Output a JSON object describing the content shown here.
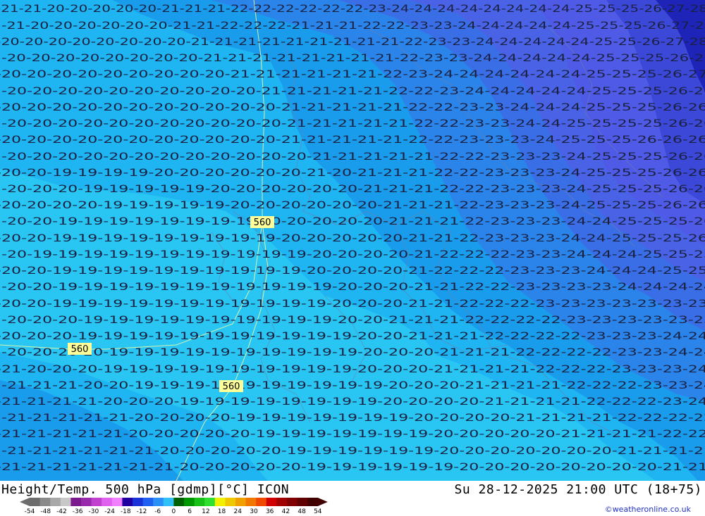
{
  "map": {
    "title": "Height/Temp. 500 hPa [gdmp][°C] ICON",
    "valid_time": "Su 28-12-2025 21:00 UTC (18+75)",
    "credit": "©weatheronline.co.uk",
    "colors": {
      "temp_minus19": "#29c6f4",
      "temp_minus20": "#1fb4f2",
      "temp_minus21": "#1a9cec",
      "temp_minus22": "#2b84ea",
      "temp_minus23": "#3a6ee6",
      "temp_minus24": "#4a63e6",
      "temp_minus25": "#4f5ae6",
      "temp_minus26": "#3c48d8",
      "temp_minus28": "#1e24b8",
      "height_contour": "#ffff99",
      "label_text": "#1a2140"
    },
    "height_labels": [
      "560",
      "560",
      "560"
    ],
    "iso_rows": [
      "21-21-20-20-20-20-20-21-21-21-22-22-22-22-22-22-23-24-24-24-24-24-24-24-24-25-25-25-26-27-28",
      "21-20-20-20-20-20-20-21-21-22-22-22-21-21-21-22-22-23-23-24-24-24-24-24-25-25-25-26-27-27",
      "20-20-20-20-20-20-20-20-21-21-21-21-21-21-21-21-21-22-23-23-24-24-24-24-24-25-25-26-27-28",
      "20-20-20-20-20-20-20-20-21-21-21-21-21-21-21-21-22-23-23-24-24-24-24-24-25-25-25-26-27",
      "20-20-20-20-20-20-20-20-20-21-21-21-21-21-21-22-23-24-24-24-24-24-24-25-25-25-26-27",
      "20-20-20-20-20-20-20-20-20-20-21-21-21-21-21-22-22-23-24-24-24-24-24-25-25-25-26-26",
      "20-20-20-20-20-20-20-20-20-20-20-21-21-21-21-21-22-22-23-23-24-24-24-25-25-25-26-26",
      "20-20-20-20-20-20-20-20-20-20-20-21-21-21-21-21-22-22-23-23-24-24-25-25-25-25-26-26",
      "20-20-20-20-20-20-20-20-20-20-20-21-21-21-21-21-22-22-23-23-23-24-25-25-25-26-26-26",
      "20-20-20-20-20-20-20-20-20-20-20-20-21-21-21-21-21-22-22-23-23-23-24-25-25-25-26-26",
      "20-20-19-19-19-19-20-20-20-20-20-20-21-20-21-21-21-22-22-23-23-23-24-25-25-25-26-26",
      "20-20-20-19-19-19-19-19-20-20-20-20-20-20-21-21-21-22-22-23-23-23-24-25-25-25-26-26",
      "20-20-20-20-19-19-19-19-19-20-20-20-20-20-20-21-21-21-22-23-23-23-24-25-25-25-26-26",
      "20-20-19-19-19-19-19-19-19-19-20-20-20-20-20-21-21-21-22-23-23-23-24-24-25-25-25-26",
      "20-20-19-19-19-19-19-19-19-19-19-20-20-20-20-20-21-21-22-23-23-23-24-24-25-25-25-26",
      "20-19-19-19-19-19-19-19-19-19-19-19-20-20-20-20-21-22-22-22-23-23-24-24-24-25-25-25",
      "20-20-19-19-19-19-19-19-19-19-19-19-20-20-20-20-21-22-22-22-23-23-23-24-24-24-25-25",
      "20-20-19-19-19-19-19-19-19-19-19-19-19-20-20-20-21-21-22-22-23-23-23-23-24-24-24-24",
      "20-20-19-19-19-19-19-19-19-19-19-19-19-20-20-20-21-21-22-22-22-23-23-23-23-23-23-23",
      "20-20-20-19-19-19-19-19-19-19-19-19-19-20-20-21-21-21-22-22-22-22-23-23-23-23-23-23",
      "20-20-20-19-19-19-19-19-19-19-19-19-19-19-20-20-21-21-21-22-22-22-22-23-23-23-24-24",
      "20-20-20-20-19-19-19-19-19-19-19-19-19-19-20-20-20-21-21-21-22-22-22-22-23-23-24-24",
      "21-20-20-20-19-19-19-19-19-19-19-19-19-19-20-20-20-21-21-21-21-22-22-22-23-23-23-24",
      "21-21-21-20-20-19-19-19-19-19-19-19-19-19-19-20-20-20-21-21-21-21-22-22-22-23-23-24",
      "21-21-21-21-20-20-20-19-19-19-19-19-19-19-19-20-20-20-20-21-21-21-21-22-22-22-23-24",
      "21-21-21-21-21-20-20-20-20-19-19-19-19-19-19-19-20-20-20-20-21-21-21-21-22-22-22-22",
      "21-21-21-21-21-20-20-20-20-20-19-19-19-19-19-19-19-20-20-20-20-20-21-21-21-21-22-22",
      "21-21-21-21-21-21-20-20-20-20-20-19-19-19-19-19-19-20-20-20-20-20-20-20-21-21-21-21",
      "21-21-21-21-21-21-21-20-20-20-20-20-19-19-19-19-19-19-20-20-20-20-20-20-20-20-21-21"
    ]
  },
  "legend": {
    "colors": [
      "#6c6c6c",
      "#8a8a8a",
      "#a8a8a8",
      "#c8c8c8",
      "#7a1a8c",
      "#9a2aac",
      "#c040d0",
      "#e060f0",
      "#f080ff",
      "#2000a0",
      "#1a32d8",
      "#2060f0",
      "#2a90f8",
      "#30c0f8",
      "#006000",
      "#009800",
      "#18c018",
      "#30e030",
      "#f0f000",
      "#f0c800",
      "#f0a000",
      "#f07800",
      "#f04800",
      "#d00000",
      "#a00000",
      "#800000",
      "#600000",
      "#400000"
    ],
    "ticks": [
      "-54",
      "-48",
      "-42",
      "-36",
      "-30",
      "-24",
      "-18",
      "-12",
      "-6",
      "0",
      "6",
      "12",
      "18",
      "24",
      "30",
      "36",
      "42",
      "48",
      "54"
    ]
  }
}
